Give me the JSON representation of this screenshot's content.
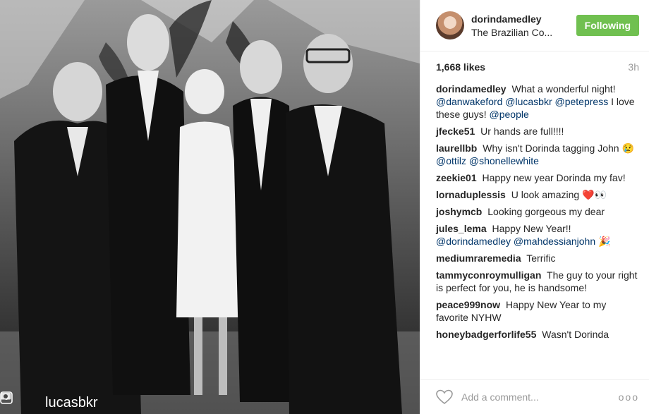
{
  "photo": {
    "repost_user": "lucasbkr"
  },
  "post": {
    "username": "dorindamedley",
    "location": "The Brazilian Co...",
    "follow_label": "Following",
    "likes": "1,668 likes",
    "time": "3h"
  },
  "comments": [
    {
      "user": "dorindamedley",
      "text": "What a wonderful night!",
      "mentions": "@danwakeford @lucasbkr @petepress",
      "tail": "I love these guys!",
      "mention2": "@people"
    },
    {
      "user": "jfecke51",
      "text": "Ur hands are full!!!!"
    },
    {
      "user": "laurellbb",
      "text": "Why isn't Dorinda tagging John",
      "emoji": "😢",
      "mentions": "@ottilz @shonellewhite"
    },
    {
      "user": "zeekie01",
      "text": "Happy new year Dorinda my fav!"
    },
    {
      "user": "lornaduplessis",
      "text": "U look amazing",
      "emoji": "❤️👀"
    },
    {
      "user": "joshymcb",
      "text": "Looking gorgeous my dear"
    },
    {
      "user": "jules_lema",
      "text": "Happy New Year!!",
      "mentions": "@dorindamedley @mahdessianjohn",
      "emoji": "🎉"
    },
    {
      "user": "mediumraremedia",
      "text": "Terrific"
    },
    {
      "user": "tammyconroymulligan",
      "text": "The guy to your right is perfect for you, he is handsome!"
    },
    {
      "user": "peace999now",
      "text": "Happy New Year to my favorite NYHW"
    },
    {
      "user": "honeybadgerforlife55",
      "text": "Wasn't Dorinda"
    }
  ],
  "footer": {
    "add_comment_placeholder": "Add a comment...",
    "more_label": "ooo"
  },
  "colors": {
    "follow_green": "#70c050",
    "mention_blue": "#003569"
  },
  "icons": [
    "repost-icon",
    "camera-icon",
    "heart-icon",
    "more-icon"
  ]
}
